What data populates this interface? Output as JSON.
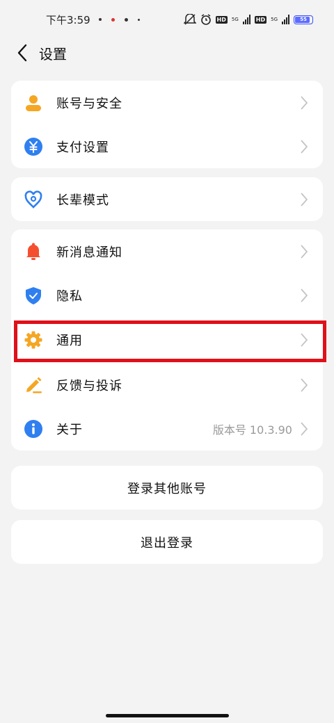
{
  "status_bar": {
    "time": "下午3:59",
    "hd1": "HD",
    "net1": "5G",
    "hd2": "HD",
    "net2": "5G",
    "battery": "55"
  },
  "header": {
    "title": "设置"
  },
  "groups": [
    {
      "items": [
        {
          "label": "账号与安全",
          "icon": "person-icon"
        },
        {
          "label": "支付设置",
          "icon": "yuan-icon"
        }
      ]
    },
    {
      "items": [
        {
          "label": "长辈模式",
          "icon": "heart-location-icon"
        }
      ]
    },
    {
      "items": [
        {
          "label": "新消息通知",
          "icon": "bell-icon"
        },
        {
          "label": "隐私",
          "icon": "shield-icon"
        },
        {
          "label": "通用",
          "icon": "gear-icon"
        },
        {
          "label": "反馈与投诉",
          "icon": "pencil-icon"
        },
        {
          "label": "关于",
          "icon": "info-icon",
          "value": "版本号 10.3.90"
        }
      ]
    }
  ],
  "actions": {
    "switch_account": "登录其他账号",
    "logout": "退出登录"
  },
  "colors": {
    "accent_blue": "#2f7ff0",
    "accent_orange": "#f5a623",
    "bell_red": "#f4502f",
    "highlight_red": "#e0101a"
  }
}
